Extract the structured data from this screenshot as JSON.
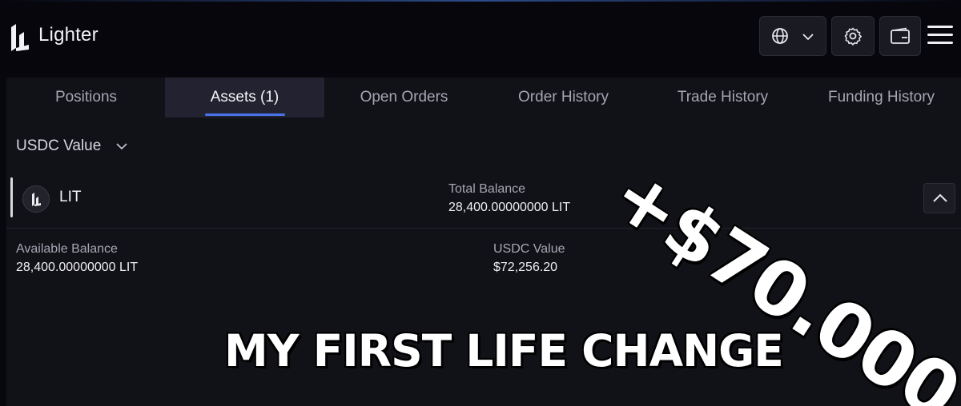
{
  "app": {
    "brand": "Lighter"
  },
  "header": {
    "icons": [
      "logo-icon",
      "globe-icon",
      "chevron-down-icon",
      "gear-icon",
      "wallet-icon",
      "menu-icon"
    ]
  },
  "tabs": [
    {
      "label": "Positions",
      "active": false
    },
    {
      "label": "Assets (1)",
      "active": true
    },
    {
      "label": "Open Orders",
      "active": false
    },
    {
      "label": "Order History",
      "active": false
    },
    {
      "label": "Trade History",
      "active": false
    },
    {
      "label": "Funding History",
      "active": false
    }
  ],
  "filter": {
    "value_select": "USDC Value"
  },
  "asset": {
    "symbol": "LIT",
    "total_balance_label": "Total Balance",
    "total_balance": "28,400.00000000 LIT",
    "available_balance_label": "Available Balance",
    "available_balance": "28,400.00000000 LIT",
    "usdc_value_label": "USDC Value",
    "usdc_value": "$72,256.20"
  },
  "overlay": {
    "amount": "+$70.000",
    "caption": "MY FIRST LIFE CHANGE"
  },
  "colors": {
    "accent": "#4a73ea",
    "background": "#07070d",
    "panel": "#111118"
  }
}
